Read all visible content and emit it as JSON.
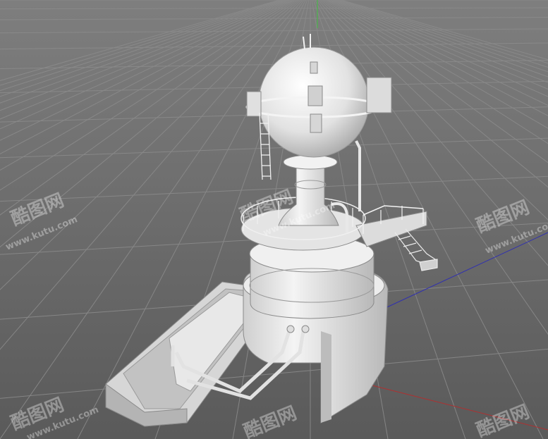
{
  "scene": {
    "subject": "tower-reactor-3d-model",
    "colors": {
      "background_top": "#7e7e7e",
      "background_bottom": "#5a5a5a",
      "grid": "#8c8c8c",
      "model": "#e6e6e6",
      "model_shadow": "#9c9c9c",
      "axis_x": "#b03030",
      "axis_y": "#3fbf3f",
      "axis_z": "#3030b0"
    }
  },
  "watermarks": [
    "酷图网",
    "www.kutu.com"
  ]
}
